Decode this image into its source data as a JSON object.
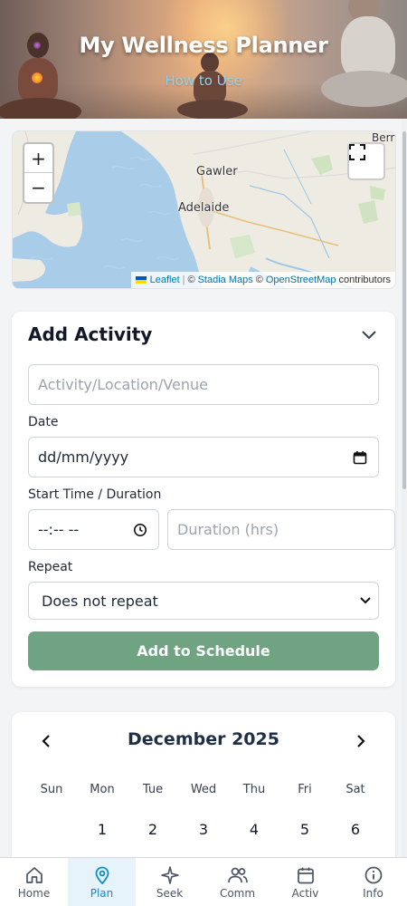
{
  "header": {
    "title": "My Wellness Planner",
    "how_to_use": "How to Use"
  },
  "map": {
    "zoom_in": "+",
    "zoom_out": "−",
    "places": [
      "Gawler",
      "Adelaide",
      "Berr"
    ],
    "attribution": {
      "leaflet": "Leaflet",
      "sep": "|",
      "copy1": "©",
      "stadia": "Stadia Maps",
      "copy2": "©",
      "osm": "OpenStreetMap",
      "contributors": "contributors"
    }
  },
  "form": {
    "title": "Add Activity",
    "activity_placeholder": "Activity/Location/Venue",
    "date_label": "Date",
    "date_value": "dd/mm/yyyy",
    "time_label": "Start Time / Duration",
    "time_value": "--:-- --",
    "duration_placeholder": "Duration (hrs)",
    "repeat_label": "Repeat",
    "repeat_value": "Does not repeat",
    "submit_label": "Add to Schedule",
    "accent_color": "#6fa382"
  },
  "calendar": {
    "prev": "‹",
    "next": "›",
    "month": "December 2025",
    "weekdays": [
      "Sun",
      "Mon",
      "Tue",
      "Wed",
      "Thu",
      "Fri",
      "Sat"
    ],
    "first_week": [
      "",
      "1",
      "2",
      "3",
      "4",
      "5",
      "6"
    ]
  },
  "bottom_nav": {
    "active": "Plan",
    "active_color": "#0b8ec9",
    "items": [
      {
        "label": "Home",
        "icon": "home-icon"
      },
      {
        "label": "Plan",
        "icon": "map-pin-icon"
      },
      {
        "label": "Seek",
        "icon": "sparkle-icon"
      },
      {
        "label": "Comm",
        "icon": "users-icon"
      },
      {
        "label": "Activ",
        "icon": "calendar-icon"
      },
      {
        "label": "Info",
        "icon": "info-icon"
      }
    ]
  }
}
